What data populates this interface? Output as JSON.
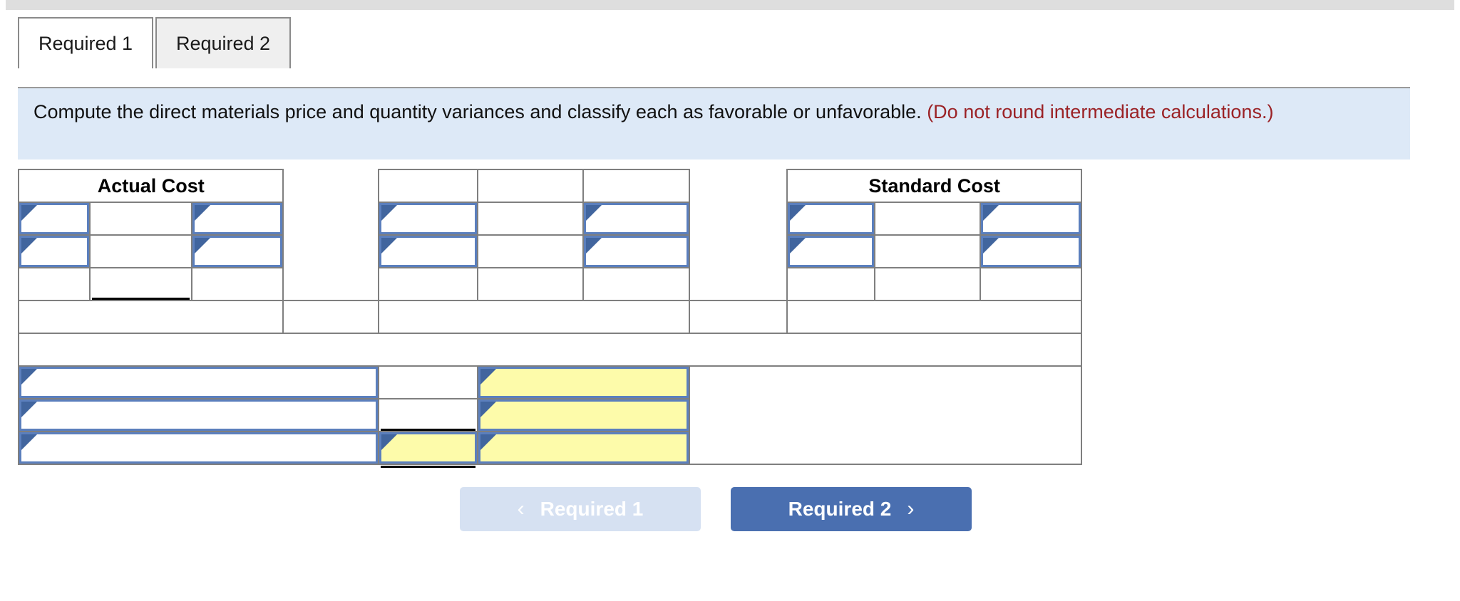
{
  "window": {
    "top_bar_color": "#dedede"
  },
  "tabs": [
    {
      "label": "Required 1",
      "state": "active"
    },
    {
      "label": "Required 2",
      "state": "inactive"
    }
  ],
  "instruction": {
    "main": "Compute the direct materials price and quantity variances and classify each as favorable or unfavorable.",
    "hint": "(Do not round intermediate calculations.)",
    "background": "#dde9f7",
    "hint_color": "#9b2226"
  },
  "worksheet": {
    "headers": {
      "actual_cost": "Actual Cost",
      "standard_cost": "Standard Cost",
      "blank": ""
    },
    "colors": {
      "header_blue": "#8aabe0",
      "input_border_blue": "#5b7fbd",
      "caret_blue": "#41659e",
      "answer_yellow": "#fdfbaa",
      "grid_gray": "#7f7f7f"
    },
    "rows": [
      {
        "name": "header-row",
        "cells": [
          {
            "kind": "header",
            "span": 3,
            "text": "Actual Cost"
          },
          {
            "kind": "gap",
            "span": 1,
            "text": ""
          },
          {
            "kind": "header",
            "span": 1,
            "text": ""
          },
          {
            "kind": "header",
            "span": 1,
            "text": ""
          },
          {
            "kind": "header",
            "span": 1,
            "text": ""
          },
          {
            "kind": "gap",
            "span": 1,
            "text": ""
          },
          {
            "kind": "header",
            "span": 3,
            "text": "Standard Cost"
          }
        ]
      },
      {
        "name": "entry-row-1",
        "cells": [
          {
            "kind": "input",
            "value": ""
          },
          {
            "kind": "input-plain",
            "value": ""
          },
          {
            "kind": "input",
            "value": ""
          },
          {
            "kind": "gap",
            "value": ""
          },
          {
            "kind": "input",
            "value": ""
          },
          {
            "kind": "input-plain",
            "value": ""
          },
          {
            "kind": "input",
            "value": ""
          },
          {
            "kind": "gap",
            "value": ""
          },
          {
            "kind": "input",
            "value": ""
          },
          {
            "kind": "input-plain",
            "value": ""
          },
          {
            "kind": "input",
            "value": ""
          }
        ]
      },
      {
        "name": "entry-row-2",
        "cells": [
          {
            "kind": "input",
            "value": ""
          },
          {
            "kind": "input-plain",
            "value": ""
          },
          {
            "kind": "input",
            "value": ""
          },
          {
            "kind": "gap",
            "value": ""
          },
          {
            "kind": "input",
            "value": ""
          },
          {
            "kind": "input-plain",
            "value": ""
          },
          {
            "kind": "input",
            "value": ""
          },
          {
            "kind": "gap",
            "value": ""
          },
          {
            "kind": "input",
            "value": ""
          },
          {
            "kind": "input-plain",
            "value": ""
          },
          {
            "kind": "input",
            "value": ""
          }
        ]
      },
      {
        "name": "subtotal-rule-row",
        "cells": [
          {
            "kind": "plain",
            "value": ""
          },
          {
            "kind": "plain-underlined",
            "value": ""
          },
          {
            "kind": "plain",
            "value": ""
          },
          {
            "kind": "gap",
            "value": ""
          },
          {
            "kind": "plain",
            "value": ""
          },
          {
            "kind": "plain",
            "value": ""
          },
          {
            "kind": "plain",
            "value": ""
          },
          {
            "kind": "gap",
            "value": ""
          },
          {
            "kind": "plain",
            "value": ""
          },
          {
            "kind": "plain",
            "value": ""
          },
          {
            "kind": "plain",
            "value": ""
          }
        ]
      },
      {
        "name": "total-row",
        "cells": [
          {
            "kind": "plain",
            "span": 3,
            "value": ""
          },
          {
            "kind": "yellow",
            "span": 1,
            "value": ""
          },
          {
            "kind": "plain",
            "span": 3,
            "value": ""
          },
          {
            "kind": "yellow",
            "span": 1,
            "value": ""
          },
          {
            "kind": "plain",
            "span": 3,
            "value": ""
          }
        ]
      },
      {
        "name": "spacer-row",
        "cells": [
          {
            "kind": "plain",
            "span": 11,
            "value": ""
          }
        ]
      },
      {
        "name": "variance-row-1",
        "cells": [
          {
            "kind": "input-wide",
            "span": 4,
            "value": ""
          },
          {
            "kind": "yellow-cell",
            "span": 1,
            "value": ""
          },
          {
            "kind": "input-yellow",
            "span": 2,
            "value": ""
          },
          {
            "kind": "plain-merged",
            "span": 4,
            "value": ""
          }
        ]
      },
      {
        "name": "variance-row-2",
        "cells": [
          {
            "kind": "input-wide",
            "span": 4,
            "value": ""
          },
          {
            "kind": "yellow-cell-ruled",
            "span": 1,
            "value": ""
          },
          {
            "kind": "input-yellow",
            "span": 2,
            "value": ""
          }
        ]
      },
      {
        "name": "variance-total-row",
        "cells": [
          {
            "kind": "input-wide",
            "span": 4,
            "value": ""
          },
          {
            "kind": "input-yellow-dbl",
            "span": 1,
            "value": ""
          },
          {
            "kind": "input-yellow",
            "span": 2,
            "value": ""
          }
        ]
      }
    ]
  },
  "navigation": {
    "prev": {
      "label": "Required 1",
      "icon": "chevron-left-icon",
      "glyph": "‹",
      "enabled": false
    },
    "next": {
      "label": "Required 2",
      "icon": "chevron-right-icon",
      "glyph": "›",
      "enabled": true
    }
  }
}
